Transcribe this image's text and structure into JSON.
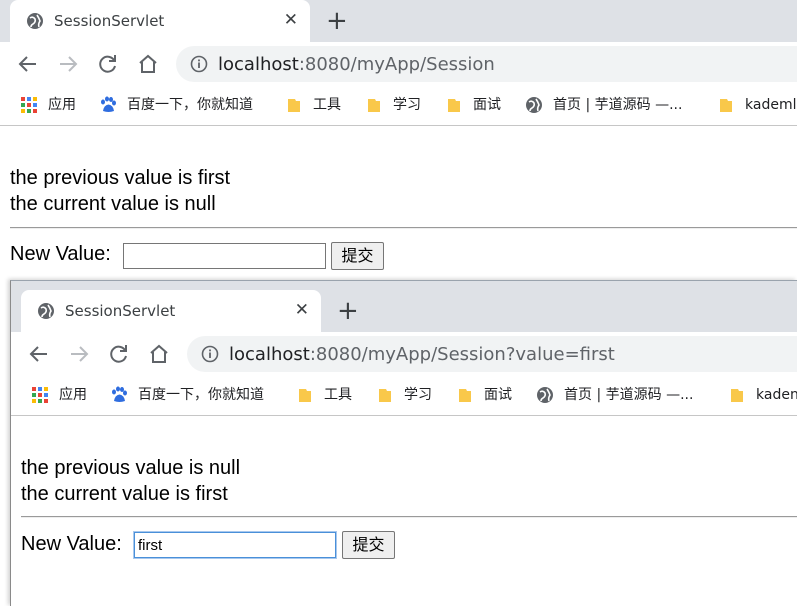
{
  "windows": [
    {
      "tab": {
        "title": "SessionServlet",
        "close": "✕"
      },
      "new_tab": "+",
      "address": {
        "host": "localhost",
        "path": ":8080/myApp/Session"
      },
      "bookmarks": [
        {
          "label": "应用",
          "icon": "apps-grid-icon"
        },
        {
          "label": "百度一下，你就知道",
          "icon": "baidu-paw-icon"
        },
        {
          "label": "工具",
          "icon": "folder-icon"
        },
        {
          "label": "学习",
          "icon": "folder-icon"
        },
        {
          "label": "面试",
          "icon": "folder-icon"
        },
        {
          "label": "首页 | 芋道源码 —...",
          "icon": "globe-icon"
        },
        {
          "label": "kademl",
          "icon": "folder-icon"
        }
      ],
      "page": {
        "previous_line": "the previous value is first",
        "current_line": "the current value is null",
        "form_label": "New Value:",
        "input_value": "",
        "submit_label": "提交"
      }
    },
    {
      "tab": {
        "title": "SessionServlet",
        "close": "✕"
      },
      "new_tab": "+",
      "address": {
        "host": "localhost",
        "path": ":8080/myApp/Session?value=first"
      },
      "bookmarks": [
        {
          "label": "应用",
          "icon": "apps-grid-icon"
        },
        {
          "label": "百度一下，你就知道",
          "icon": "baidu-paw-icon"
        },
        {
          "label": "工具",
          "icon": "folder-icon"
        },
        {
          "label": "学习",
          "icon": "folder-icon"
        },
        {
          "label": "面试",
          "icon": "folder-icon"
        },
        {
          "label": "首页 | 芋道源码 —...",
          "icon": "globe-icon"
        },
        {
          "label": "kaden",
          "icon": "folder-icon"
        }
      ],
      "page": {
        "previous_line": "the previous value is null",
        "current_line": "the current value is first",
        "form_label": "New Value:",
        "input_value": "first",
        "submit_label": "提交"
      }
    }
  ],
  "colors": {
    "tabstrip": "#dee1e6",
    "omnibox": "#f1f3f4",
    "folder": "#f9c84a",
    "focus": "#4a90d9"
  }
}
